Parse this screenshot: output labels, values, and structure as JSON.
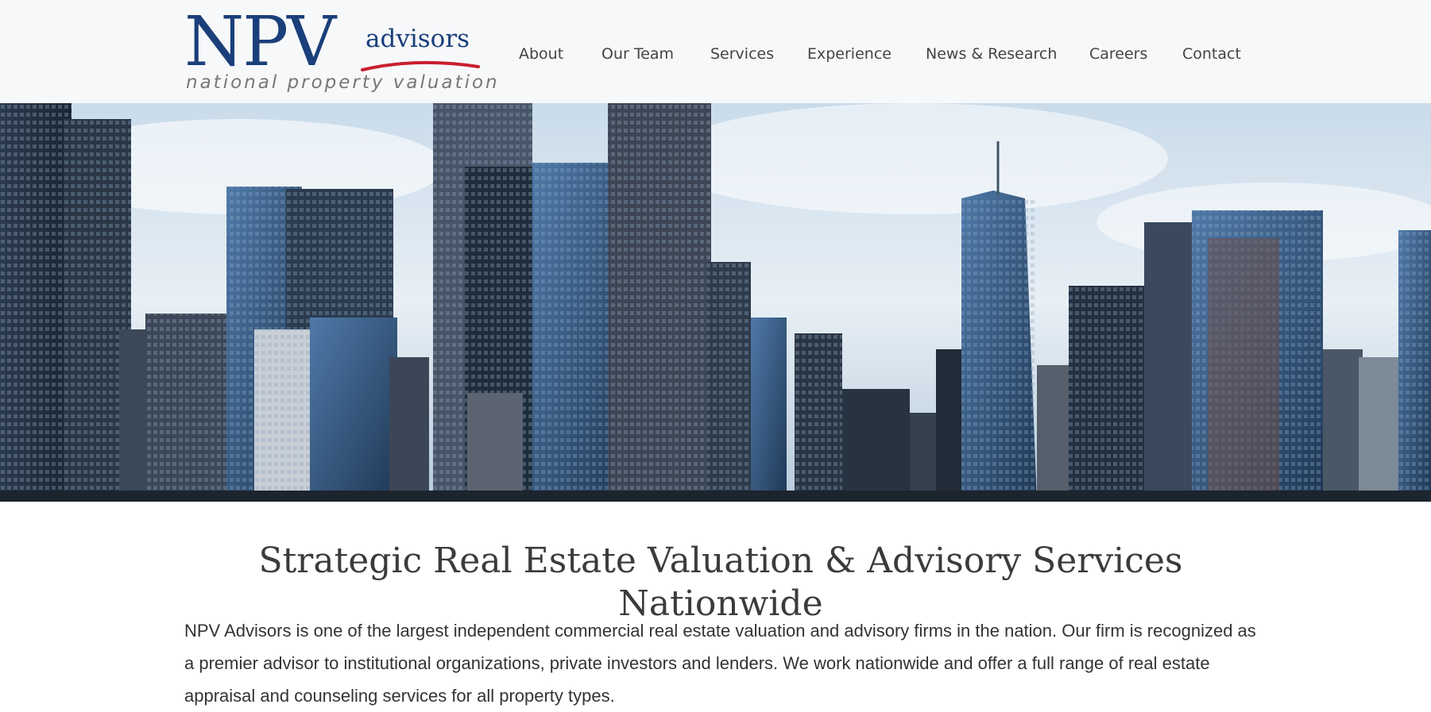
{
  "logo": {
    "primary": "NPV",
    "secondary": "advisors",
    "tagline": "national property valuation",
    "color": "#1a3f7a",
    "accent": "#c8202e"
  },
  "nav": {
    "items": [
      {
        "label": "About"
      },
      {
        "label": "Our Team"
      },
      {
        "label": "Services"
      },
      {
        "label": "Experience"
      },
      {
        "label": "News & Research"
      },
      {
        "label": "Careers"
      },
      {
        "label": "Contact"
      }
    ]
  },
  "hero": {
    "image": "city-skyline-photo"
  },
  "main": {
    "headline": "Strategic Real Estate Valuation & Advisory Services Nationwide",
    "intro": "NPV Advisors is one of the largest independent commercial real estate valuation and advisory firms in the nation. Our firm is recognized as a premier advisor to institutional organizations, private investors and lenders. We work nationwide and offer a full range of real estate appraisal and counseling services for all property types."
  }
}
